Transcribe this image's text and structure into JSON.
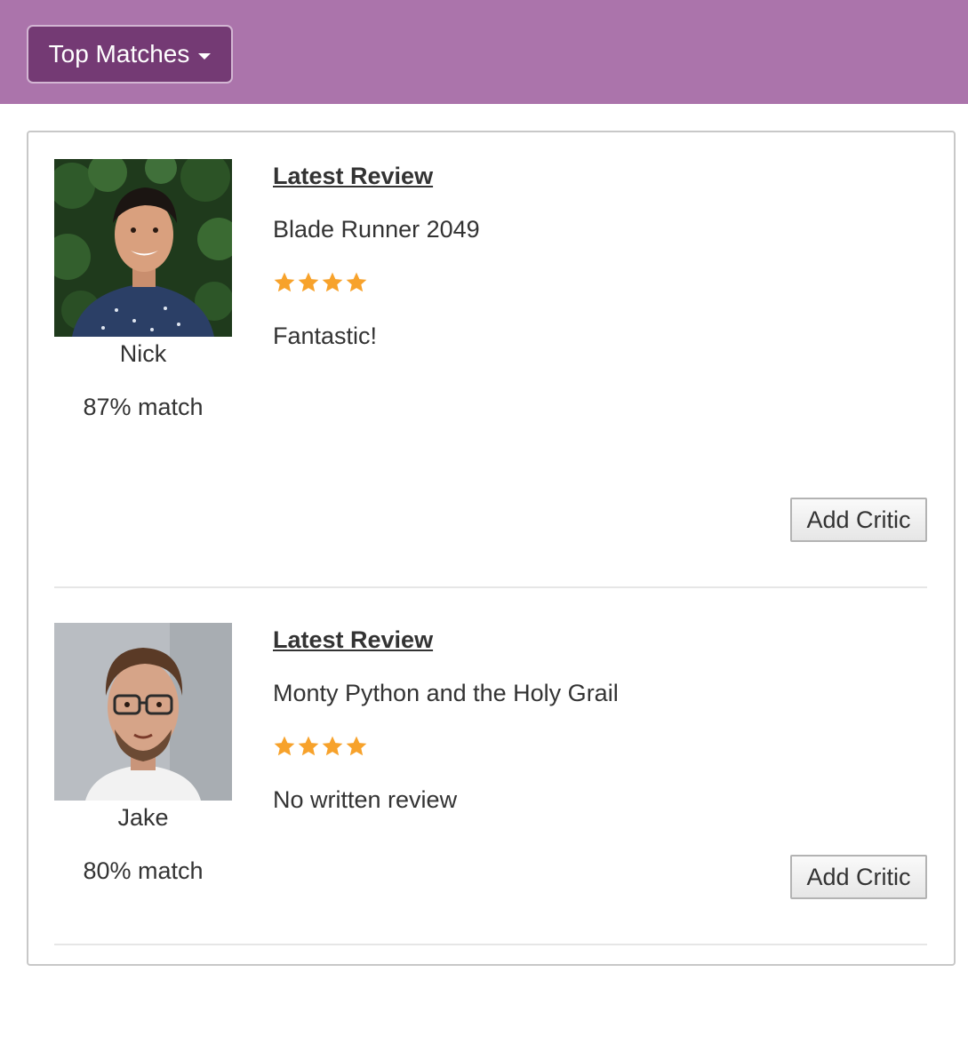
{
  "header": {
    "dropdown_label": "Top Matches",
    "background": "#ab74ab",
    "button_color": "#743a74"
  },
  "critics": [
    {
      "name": "Nick",
      "match": "87% match",
      "review_heading": "Latest Review",
      "movie": "Blade Runner 2049",
      "rating": 4,
      "review_text": "Fantastic!",
      "add_label": "Add Critic"
    },
    {
      "name": "Jake",
      "match": "80% match",
      "review_heading": "Latest Review",
      "movie": "Monty Python and the Holy Grail",
      "rating": 4,
      "review_text": "No written review",
      "add_label": "Add Critic"
    }
  ],
  "colors": {
    "star": "#f7a22b",
    "text": "#333333"
  }
}
